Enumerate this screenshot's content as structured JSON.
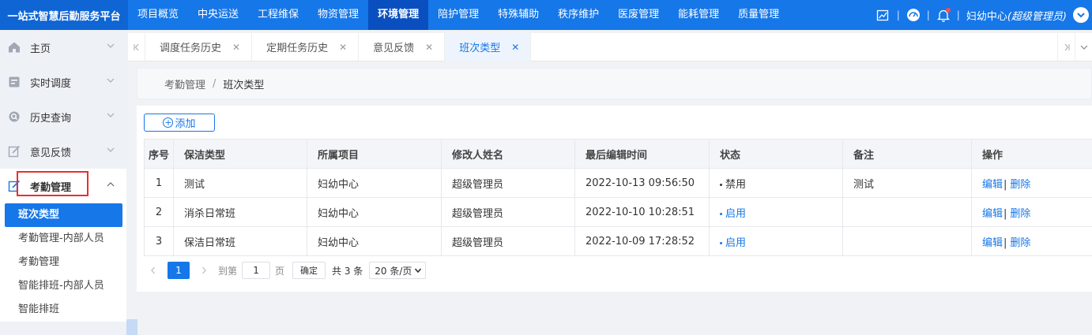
{
  "header": {
    "brand": "一站式智慧后勤服务平台",
    "nav": [
      "项目概览",
      "中央运送",
      "工程维保",
      "物资管理",
      "环境管理",
      "陪护管理",
      "特殊辅助",
      "秩序维护",
      "医废管理",
      "能耗管理",
      "质量管理"
    ],
    "active_nav": "环境管理",
    "user_org": "妇幼中心",
    "user_role": "(超级管理员)",
    "sep": "|"
  },
  "sidebar": {
    "items": [
      {
        "label": "主页",
        "icon": "home-icon"
      },
      {
        "label": "实时调度",
        "icon": "dispatch-icon"
      },
      {
        "label": "历史查询",
        "icon": "history-icon"
      },
      {
        "label": "意见反馈",
        "icon": "feedback-icon"
      },
      {
        "label": "考勤管理",
        "icon": "attendance-icon"
      }
    ],
    "submenu": [
      "班次类型",
      "考勤管理-内部人员",
      "考勤管理",
      "智能排班-内部人员",
      "智能排班"
    ]
  },
  "tabs": [
    {
      "label": "调度任务历史"
    },
    {
      "label": "定期任务历史"
    },
    {
      "label": "意见反馈"
    },
    {
      "label": "班次类型"
    }
  ],
  "breadcrumb": {
    "parent": "考勤管理",
    "sep": "/",
    "current": "班次类型"
  },
  "toolbar": {
    "add_label": "添加"
  },
  "table": {
    "headers": [
      "序号",
      "保洁类型",
      "所属项目",
      "修改人姓名",
      "最后编辑时间",
      "状态",
      "备注",
      "操作"
    ],
    "rows": [
      {
        "no": "1",
        "type": "测试",
        "project": "妇幼中心",
        "editor": "超级管理员",
        "time": "2022-10-13 09:56:50",
        "status": "禁用",
        "note": "测试",
        "edit": "编辑",
        "sep": "|",
        "del": "删除"
      },
      {
        "no": "2",
        "type": "消杀日常班",
        "project": "妇幼中心",
        "editor": "超级管理员",
        "time": "2022-10-10 10:28:51",
        "status": "启用",
        "note": "",
        "edit": "编辑",
        "sep": "|",
        "del": "删除"
      },
      {
        "no": "3",
        "type": "保洁日常班",
        "project": "妇幼中心",
        "editor": "超级管理员",
        "time": "2022-10-09 17:28:52",
        "status": "启用",
        "note": "",
        "edit": "编辑",
        "sep": "|",
        "del": "删除"
      }
    ]
  },
  "pager": {
    "current": "1",
    "goto_label": "到第",
    "goto_value": "1",
    "page_unit": "页",
    "confirm": "确定",
    "total": "共 3 条",
    "page_size": "20 条/页"
  },
  "colors": {
    "primary": "#1677e8",
    "highlight_box": "#e8302d"
  }
}
